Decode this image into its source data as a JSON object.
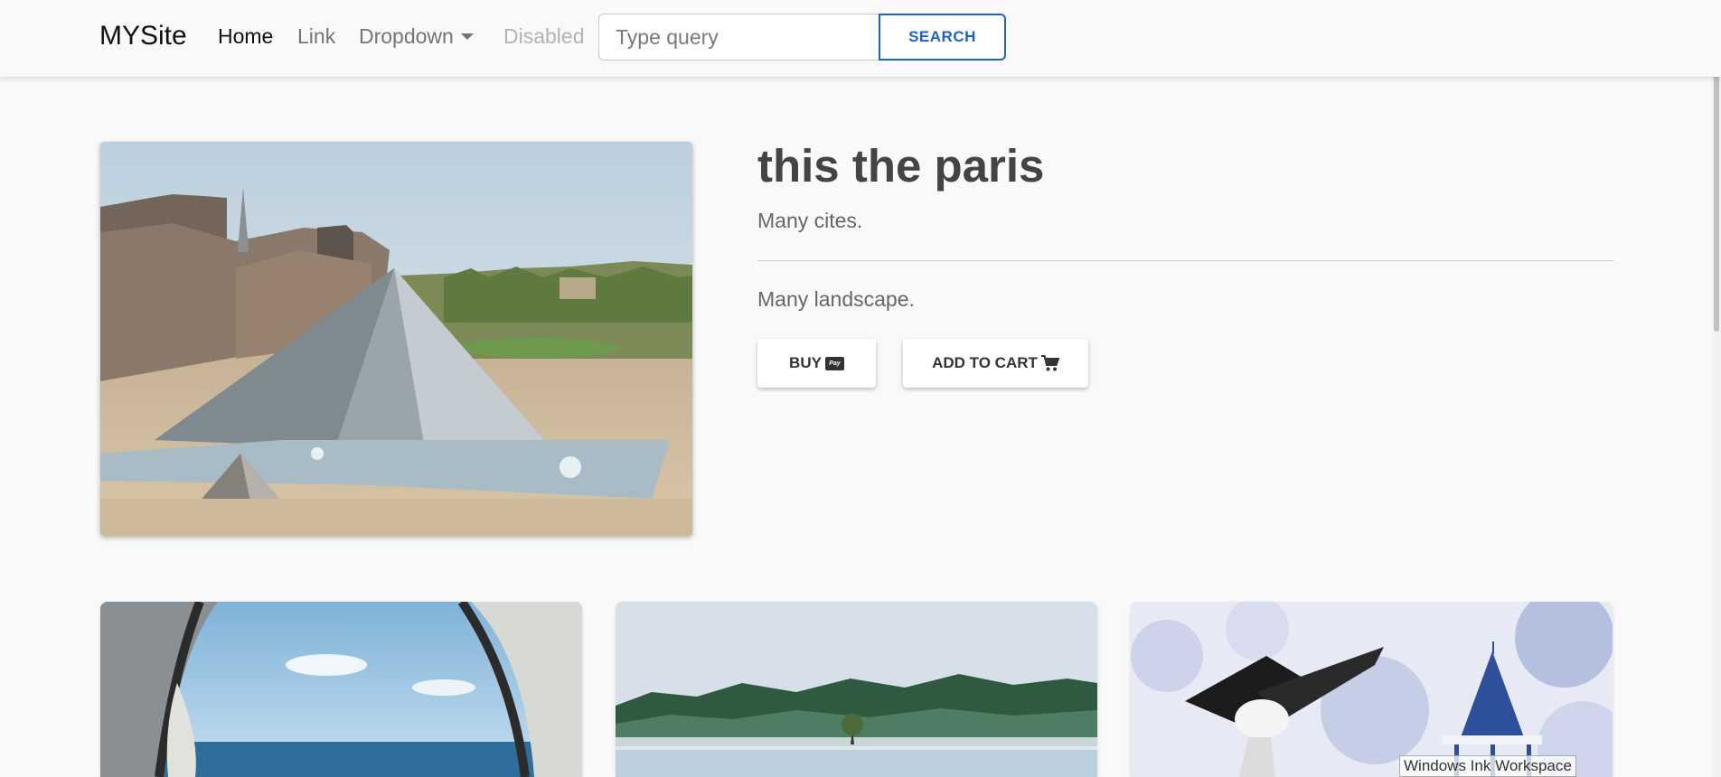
{
  "nav": {
    "brand": "MYSite",
    "items": [
      "Home",
      "Link",
      "Dropdown",
      "Disabled"
    ],
    "search_placeholder": "Type query",
    "search_button": "SEARCH"
  },
  "hero": {
    "image_icon": "paris-louvre-photo",
    "title": "this the paris",
    "subtitle": "Many cites.",
    "description": "Many landscape.",
    "buy_label": "BUY",
    "buy_icon": "paypal-icon",
    "cart_label": "ADD TO CART",
    "cart_icon": "cart-icon"
  },
  "cards": [
    {
      "image_icon": "tent-sea-photo"
    },
    {
      "image_icon": "lake-forest-photo"
    },
    {
      "image_icon": "snow-bird-gazebo-photo"
    }
  ],
  "overlay": {
    "ink_workspace": "Windows Ink Workspace"
  }
}
